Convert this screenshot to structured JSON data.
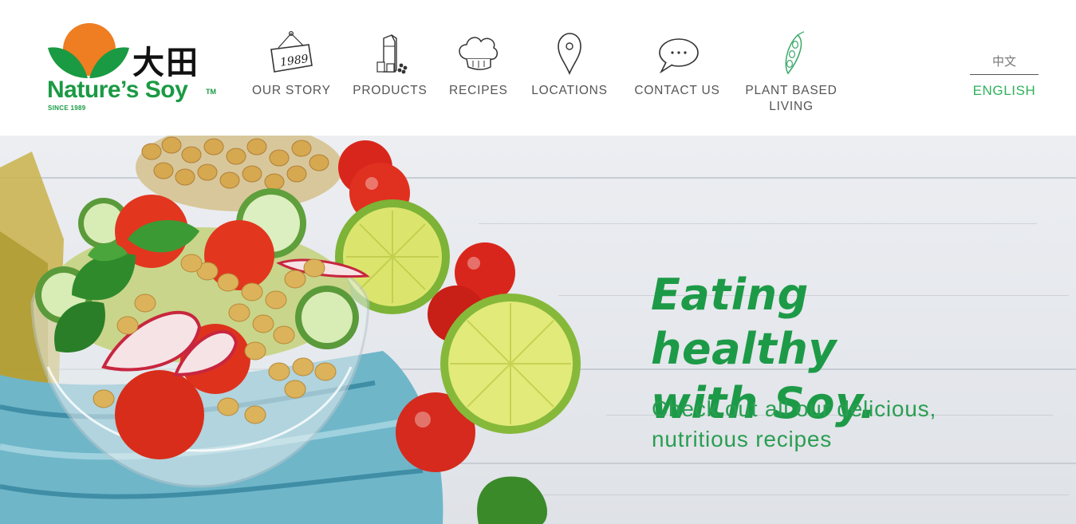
{
  "brand": {
    "cjk": "大田",
    "name": "Nature’s Soy",
    "tm": "TM",
    "since": "SINCE 1989",
    "colors": {
      "green": "#1a9a43",
      "orange": "#ef7d22"
    }
  },
  "nav": {
    "items": [
      {
        "label": "OUR STORY",
        "icon": "1989-sign-icon"
      },
      {
        "label": "PRODUCTS",
        "icon": "soy-milk-carton-icon"
      },
      {
        "label": "RECIPES",
        "icon": "chef-hat-icon"
      },
      {
        "label": "LOCATIONS",
        "icon": "map-pin-icon"
      },
      {
        "label": "CONTACT US",
        "icon": "speech-bubble-icon"
      },
      {
        "label": "PLANT BASED",
        "label2": "LIVING",
        "icon": "soybean-pod-icon"
      }
    ],
    "sign_text": "1989"
  },
  "language": {
    "chinese": "中文",
    "english": "ENGLISH",
    "active": "ENGLISH",
    "active_color": "#2eb25a"
  },
  "hero": {
    "headline_line1": "Eating healthy",
    "headline_line2": "with Soy.",
    "subtitle_line1": "Check out all our delicious,",
    "subtitle_line2": "nutritious recipes",
    "text_color": "#1d9a47"
  }
}
